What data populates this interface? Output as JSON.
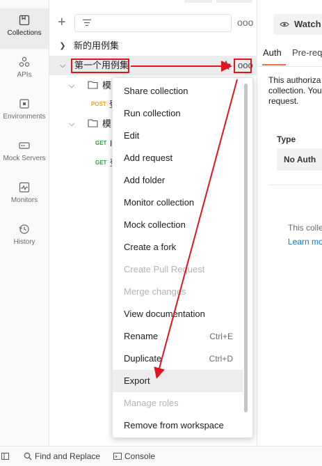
{
  "rail": {
    "items": [
      {
        "label": "Collections",
        "icon": "collections-icon",
        "active": true
      },
      {
        "label": "APIs",
        "icon": "apis-icon"
      },
      {
        "label": "Environments",
        "icon": "environments-icon"
      },
      {
        "label": "Mock Servers",
        "icon": "mock-servers-icon"
      },
      {
        "label": "Monitors",
        "icon": "monitors-icon"
      },
      {
        "label": "History",
        "icon": "history-icon"
      }
    ]
  },
  "sidebar": {
    "more_label": "ooo",
    "tree": [
      {
        "label": "新的用例集",
        "expanded": false
      },
      {
        "label": "第一个用例集",
        "expanded": true,
        "selected": true
      }
    ],
    "folder_labels": [
      "模",
      "模"
    ],
    "requests": [
      {
        "method": "POST",
        "name": "登"
      },
      {
        "method": "GET",
        "name": "I"
      },
      {
        "method": "GET",
        "name": "登"
      }
    ]
  },
  "context_menu": {
    "items": [
      {
        "label": "Share collection",
        "shortcut": "",
        "disabled": false
      },
      {
        "label": "Run collection",
        "shortcut": "",
        "disabled": false
      },
      {
        "label": "Edit",
        "shortcut": "",
        "disabled": false
      },
      {
        "label": "Add request",
        "shortcut": "",
        "disabled": false
      },
      {
        "label": "Add folder",
        "shortcut": "",
        "disabled": false
      },
      {
        "label": "Monitor collection",
        "shortcut": "",
        "disabled": false
      },
      {
        "label": "Mock collection",
        "shortcut": "",
        "disabled": false
      },
      {
        "label": "Create a fork",
        "shortcut": "",
        "disabled": false
      },
      {
        "label": "Create Pull Request",
        "shortcut": "",
        "disabled": true
      },
      {
        "label": "Merge changes",
        "shortcut": "",
        "disabled": true
      },
      {
        "label": "View documentation",
        "shortcut": "",
        "disabled": false
      },
      {
        "label": "Rename",
        "shortcut": "Ctrl+E",
        "disabled": false
      },
      {
        "label": "Duplicate",
        "shortcut": "Ctrl+D",
        "disabled": false
      },
      {
        "label": "Export",
        "shortcut": "",
        "disabled": false,
        "hover": true
      },
      {
        "label": "Manage roles",
        "shortcut": "",
        "disabled": true
      },
      {
        "label": "Remove from workspace",
        "shortcut": "",
        "disabled": false
      }
    ]
  },
  "right_pane": {
    "watch_label": "Watch",
    "tabs": [
      "Auth",
      "Pre-req"
    ],
    "description": [
      "This authoriza",
      "collection. You",
      "request."
    ],
    "type_label": "Type",
    "auth_type": "No Auth",
    "info_text": "This colle",
    "learn_more": "Learn mo"
  },
  "statusbar": {
    "find_replace": "Find and Replace",
    "console": "Console"
  },
  "colors": {
    "annotation_red": "#e0141e",
    "accent_orange": "#f26b3a",
    "post": "#f0a30a",
    "get": "#2aa640",
    "link": "#097bed"
  }
}
